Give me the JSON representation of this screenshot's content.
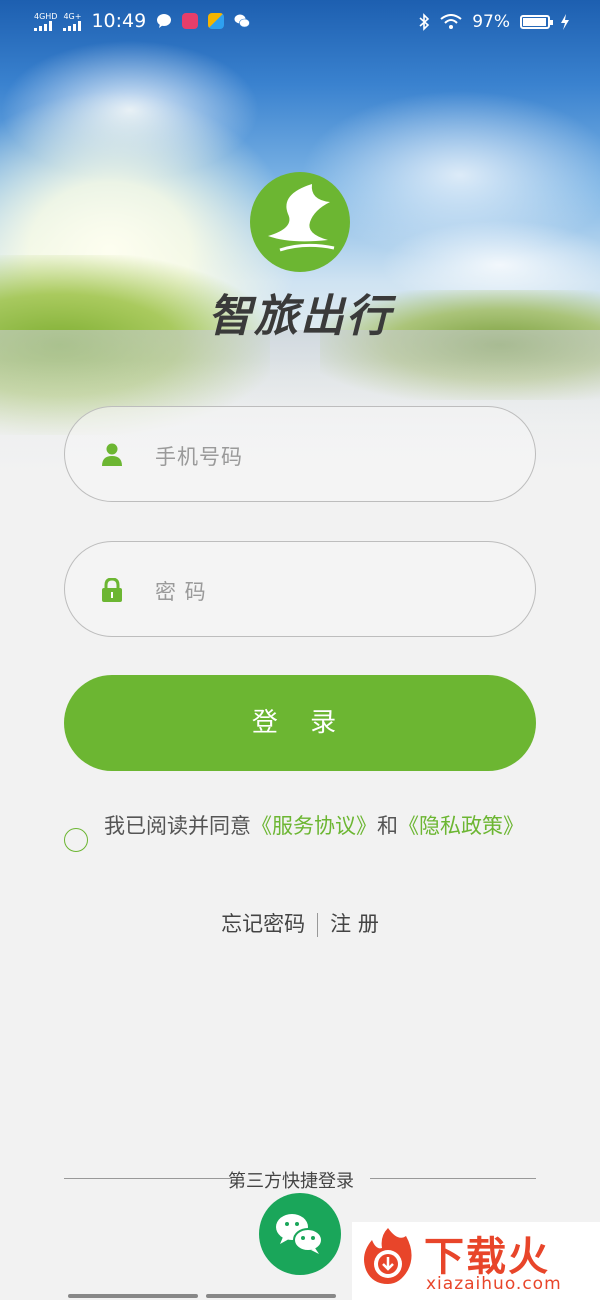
{
  "status_bar": {
    "sim1": "4GHD",
    "sim2": "4G+",
    "time": "10:49",
    "battery": "97%",
    "battery_level": 0.97,
    "icons": [
      "message-icon",
      "app-icon",
      "app-grid-icon",
      "wechat-icon",
      "bluetooth-icon",
      "wifi-icon",
      "battery-icon",
      "charging-icon"
    ]
  },
  "brand": {
    "name": "智旅出行",
    "accent_color": "#6cb632"
  },
  "login": {
    "phone_placeholder": "手机号码",
    "password_placeholder": "密 码",
    "submit_label": "登 录"
  },
  "agreement": {
    "prefix": "我已阅读并同意",
    "service_link": "《服务协议》",
    "and": "和",
    "privacy_link": "《隐私政策》"
  },
  "links": {
    "forgot": "忘记密码",
    "register": "注 册"
  },
  "third_party": {
    "label": "第三方快捷登录",
    "wechat_color": "#1aa65a"
  },
  "watermark": {
    "title": "下载火",
    "url": "xiazaihuo.com"
  }
}
